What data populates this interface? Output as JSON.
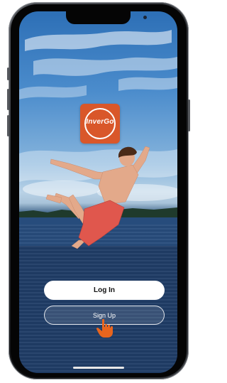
{
  "logo": {
    "text": "InverGo",
    "icon": "invergo-logo-icon",
    "color": "#d9572a"
  },
  "buttons": {
    "login_label": "Log In",
    "signup_label": "Sign Up"
  },
  "pointer": {
    "icon": "tap-hand-icon",
    "color": "#e8651e"
  }
}
